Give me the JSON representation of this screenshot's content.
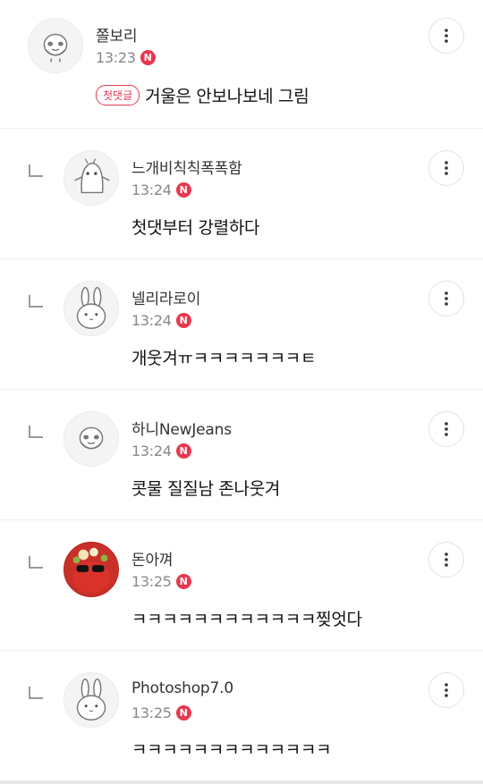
{
  "comments": [
    {
      "nickname": "쫄보리",
      "time": "13:23",
      "badge": "N",
      "first_tag": "첫댓글",
      "text": "거울은 안보나보네 그림"
    },
    {
      "nickname": "느개비칙칙폭폭함",
      "time": "13:24",
      "badge": "N",
      "text": "첫댓부터 강렬하다"
    },
    {
      "nickname": "넬리라로이",
      "time": "13:24",
      "badge": "N",
      "text": "개웃겨ㅠㅋㅋㅋㅋㅋㅋㅋㅌ"
    },
    {
      "nickname": "하니NewJeans",
      "time": "13:24",
      "badge": "N",
      "text": "콧물 질질남 존나웃겨"
    },
    {
      "nickname": "돈아껴",
      "time": "13:25",
      "badge": "N",
      "text": "ㅋㅋㅋㅋㅋㅋㅋㅋㅋㅋㅋㅋ찢엇다"
    },
    {
      "nickname": "Photoshop7.0",
      "time": "13:25",
      "badge": "N",
      "text": "ㅋㅋㅋㅋㅋㅋㅋㅋㅋㅋㅋㅋㅋ"
    }
  ],
  "icons": {
    "more": "more-vertical-icon",
    "reply": "reply-arrow-icon",
    "new": "new-badge-icon"
  },
  "colors": {
    "badge": "#e8384f",
    "meta": "#888888",
    "divider": "#eeeeee"
  }
}
